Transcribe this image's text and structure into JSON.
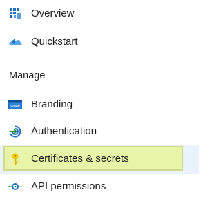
{
  "nav": {
    "items": [
      {
        "label": "Overview",
        "icon": "overview-grid-icon"
      },
      {
        "label": "Quickstart",
        "icon": "cloud-lightning-icon"
      }
    ],
    "manage": {
      "header": "Manage",
      "items": [
        {
          "label": "Branding",
          "icon": "www-browser-icon"
        },
        {
          "label": "Authentication",
          "icon": "auth-arrow-icon"
        },
        {
          "label": "Certificates & secrets",
          "icon": "key-icon",
          "selected": true
        },
        {
          "label": "API permissions",
          "icon": "api-permissions-icon"
        }
      ]
    }
  },
  "colors": {
    "selected_band": "#eaf2fb",
    "highlight": "#e8f5a8",
    "accent_blue": "#0078d4",
    "accent_green": "#2e8b57",
    "key_yellow": "#f2c811"
  }
}
